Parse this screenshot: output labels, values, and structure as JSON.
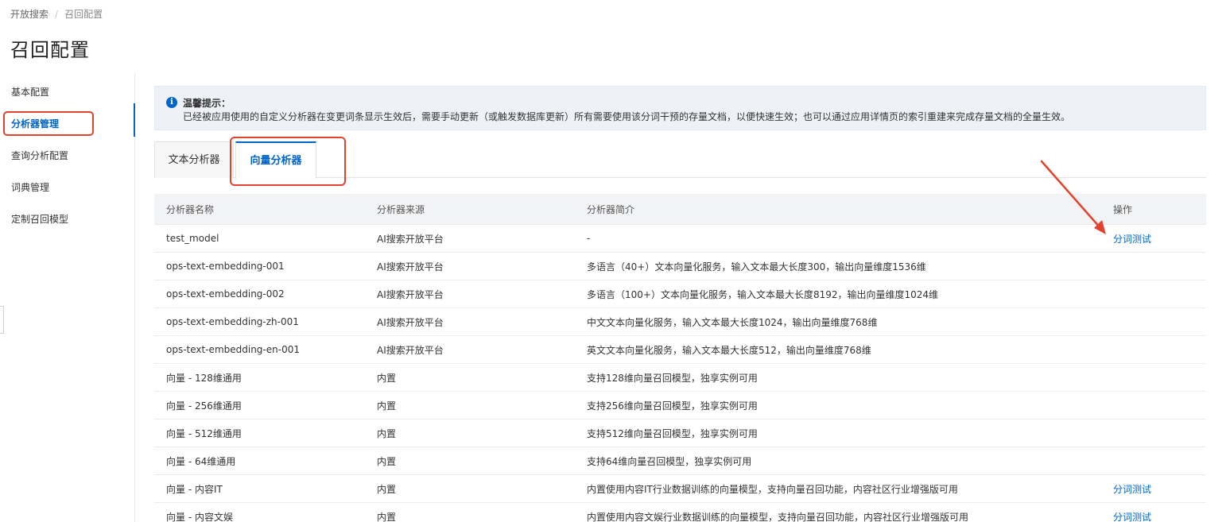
{
  "breadcrumb": {
    "root": "开放搜索",
    "separator": "/",
    "current": "召回配置"
  },
  "page_title": "召回配置",
  "sidebar": {
    "items": [
      {
        "label": "基本配置"
      },
      {
        "label": "分析器管理"
      },
      {
        "label": "查询分析配置"
      },
      {
        "label": "词典管理"
      },
      {
        "label": "定制召回模型"
      }
    ],
    "active_index": 1
  },
  "notice": {
    "title": "温馨提示：",
    "text": "已经被应用使用的自定义分析器在变更词条显示生效后，需要手动更新（或触发数据库更新）所有需要使用该分词干预的存量文档，以便快速生效；也可以通过应用详情页的索引重建来完成存量文档的全量生效。"
  },
  "tabs": [
    {
      "label": "文本分析器"
    },
    {
      "label": "向量分析器"
    }
  ],
  "active_tab": 1,
  "table": {
    "headers": [
      "分析器名称",
      "分析器来源",
      "分析器简介",
      "操作"
    ],
    "rows": [
      {
        "name": "test_model",
        "source": "AI搜索开放平台",
        "desc": "-",
        "op": "分词测试"
      },
      {
        "name": "ops-text-embedding-001",
        "source": "AI搜索开放平台",
        "desc": "多语言（40+）文本向量化服务，输入文本最大长度300，输出向量维度1536维",
        "op": ""
      },
      {
        "name": "ops-text-embedding-002",
        "source": "AI搜索开放平台",
        "desc": "多语言（100+）文本向量化服务，输入文本最大长度8192，输出向量维度1024维",
        "op": ""
      },
      {
        "name": "ops-text-embedding-zh-001",
        "source": "AI搜索开放平台",
        "desc": "中文文本向量化服务，输入文本最大长度1024，输出向量维度768维",
        "op": ""
      },
      {
        "name": "ops-text-embedding-en-001",
        "source": "AI搜索开放平台",
        "desc": "英文文本向量化服务，输入文本最大长度512，输出向量维度768维",
        "op": ""
      },
      {
        "name": "向量 - 128维通用",
        "source": "内置",
        "desc": "支持128维向量召回模型，独享实例可用",
        "op": ""
      },
      {
        "name": "向量 - 256维通用",
        "source": "内置",
        "desc": "支持256维向量召回模型，独享实例可用",
        "op": ""
      },
      {
        "name": "向量 - 512维通用",
        "source": "内置",
        "desc": "支持512维向量召回模型，独享实例可用",
        "op": ""
      },
      {
        "name": "向量 - 64维通用",
        "source": "内置",
        "desc": "支持64维向量召回模型，独享实例可用",
        "op": ""
      },
      {
        "name": "向量 - 内容IT",
        "source": "内置",
        "desc": "内置使用内容IT行业数据训练的向量模型，支持向量召回功能，内容社区行业增强版可用",
        "op": "分词测试"
      },
      {
        "name": "向量 - 内容文娱",
        "source": "内置",
        "desc": "内置使用内容文娱行业数据训练的向量模型，支持向量召回功能，内容社区行业增强版可用",
        "op": "分词测试"
      }
    ]
  },
  "colors": {
    "accent": "#0064c8",
    "highlight": "#e2432e",
    "notice_bg": "#eef1f6"
  },
  "icons": {
    "notice": "info-icon",
    "annotation": "red-arrow"
  }
}
